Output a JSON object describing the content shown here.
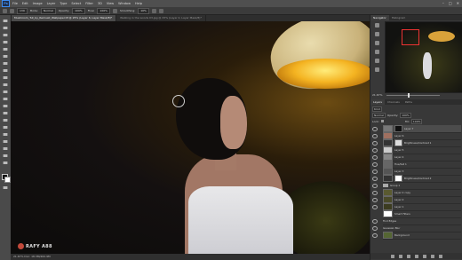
{
  "menubar": {
    "logo": "Ps",
    "items": [
      "File",
      "Edit",
      "Image",
      "Layer",
      "Type",
      "Select",
      "Filter",
      "3D",
      "View",
      "Window",
      "Help"
    ],
    "window_controls": [
      "–",
      "□",
      "✕"
    ]
  },
  "options": {
    "size": "139",
    "mode_label": "Mode:",
    "mode_value": "Normal",
    "opacity_label": "Opacity:",
    "opacity_value": "100%",
    "flow_label": "Flow:",
    "flow_value": "100%",
    "smoothing_label": "Smoothing:",
    "smoothing_value": "10%"
  },
  "tabs": [
    {
      "label": "Mushroom_Tut_by_Remus0_Wallpaper.tif @ 25% (Layer 6, Layer Mask/8)*"
    },
    {
      "label": "Walking in the woods 03.jpg @ 33% (Layer 0, Layer Mask/8)*"
    }
  ],
  "watermark": "RAFY A88",
  "statusbar": "21.67%    Doc: 18.3M/462.9M",
  "panels": {
    "nav_tabs": [
      "Navigator",
      "Histogram"
    ],
    "zoom": "21.67%",
    "layer_tabs": [
      "Layers",
      "Channels",
      "Paths"
    ],
    "kind_label": "Kind",
    "blend_mode": "Normal",
    "opacity_label": "Opacity:",
    "opacity_value": "100%",
    "lock_label": "Lock:",
    "fill_label": "Fill:",
    "fill_value": "100%",
    "layers": [
      {
        "name": "Layer 7"
      },
      {
        "name": "Layer 6"
      },
      {
        "name": "Brightness/Contrast 1"
      },
      {
        "name": "Layer 5"
      },
      {
        "name": "Layer 4"
      },
      {
        "name": "Hue/Sat 1"
      },
      {
        "name": "Layer 3"
      },
      {
        "name": "Brightness/Contrast 2"
      },
      {
        "name": "Group 1"
      },
      {
        "name": "Layer 2 copy"
      },
      {
        "name": "Layer 2"
      },
      {
        "name": "Layer 1"
      },
      {
        "name": "Smart Filters"
      },
      {
        "name": "Find Edges"
      },
      {
        "name": "Gaussian Blur"
      },
      {
        "name": "Background"
      }
    ]
  },
  "colors": {
    "accent": "#3d8bf0",
    "foreground": "#000000",
    "background": "#ffffff"
  }
}
